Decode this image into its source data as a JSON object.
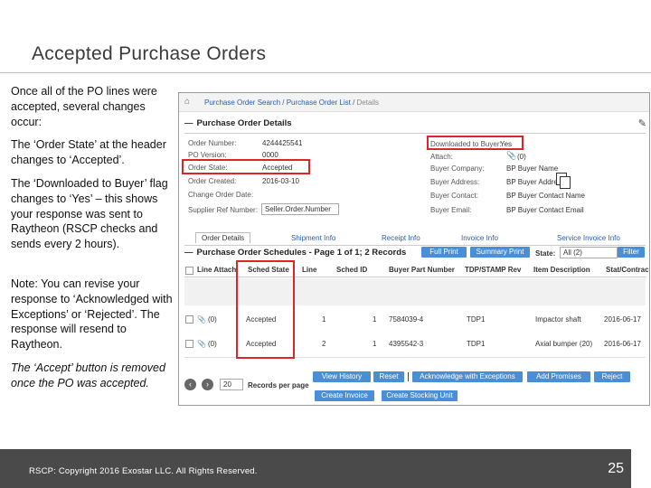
{
  "slide": {
    "title": "Accepted Purchase Orders",
    "notes": {
      "p1": "Once all of the PO lines were accepted, several changes occur:",
      "p2": "The ‘Order State’ at the header changes to ‘Accepted’.",
      "p3": "The ‘Downloaded to Buyer’ flag changes to ‘Yes’ – this shows your response was sent to Raytheon (RSCP checks and sends every 2 hours).",
      "p4": "Note:  You can revise your response to ‘Acknowledged with Exceptions’ or ‘Rejected’. The response will resend to Raytheon.",
      "p5": "The ‘Accept’ button is removed once the PO was accepted."
    },
    "footer": {
      "copyright": "RSCP:  Copyright 2016 Exostar LLC. All Rights Reserved.",
      "page_number": "25"
    }
  },
  "app": {
    "breadcrumb": {
      "part1": "Purchase Order Search",
      "sep1": " / ",
      "part2": "Purchase Order List",
      "sep2": " / ",
      "part3": "Details"
    },
    "details": {
      "heading": "Purchase Order Details",
      "order_number_label": "Order Number:",
      "order_number": "4244425541",
      "po_version_label": "PO Version:",
      "po_version": "0000",
      "order_state_label": "Order State:",
      "order_state": "Accepted",
      "order_created_label": "Order Created:",
      "order_created": "2016-03-10",
      "change_order_date_label": "Change Order Date:",
      "supplier_ref_label": "Supplier Ref Number:",
      "supplier_ref_value": "Seller.Order.Number",
      "downloaded_label": "Downloaded to Buyer:",
      "downloaded_value": "Yes",
      "attach_label": "Attach:",
      "attach_value": "(0)",
      "buyer_company_label": "Buyer Company:",
      "buyer_company": "BP Buyer Name",
      "buyer_address_label": "Buyer Address:",
      "buyer_address": "BP Buyer Address",
      "buyer_contact_label": "Buyer Contact:",
      "buyer_contact": "BP Buyer Contact Name",
      "buyer_email_label": "Buyer Email:",
      "buyer_email": "BP Buyer Contact Email"
    },
    "tabs": [
      "Order Details",
      "Shipment Info",
      "Receipt Info",
      "Invoice Info",
      "Service Invoice Info"
    ],
    "schedules": {
      "heading": "Purchase Order Schedules - Page 1 of 1; 2 Records",
      "full_print": "Full Print",
      "summary_print": "Summary Print",
      "state_label": "State:",
      "state_value": "All (2)",
      "filter": "Filter"
    },
    "columns": [
      "Line Attach",
      "Sched State",
      "Line",
      "Sched ID",
      "Buyer Part Number",
      "TDP/STAMP Rev",
      "Item Description",
      "Stat/Contrac"
    ],
    "rows": [
      {
        "attach": "(0)",
        "state": "Accepted",
        "line": "1",
        "sched": "1",
        "part": "7584039-4",
        "tdp": "TDP1",
        "desc": "Impactor shaft",
        "date": "2016-06-17"
      },
      {
        "attach": "(0)",
        "state": "Accepted",
        "line": "2",
        "sched": "1",
        "part": "4395542-3",
        "tdp": "TDP1",
        "desc": "Axial bumper (20)",
        "date": "2016-06-17"
      }
    ],
    "pager": {
      "per_page": "20",
      "label": "Records per page"
    },
    "actions": {
      "view_history": "View History",
      "reset": "Reset",
      "ack_exceptions": "Acknowledge with Exceptions",
      "add_promises": "Add Promises",
      "reject": "Reject",
      "create_invoice": "Create Invoice",
      "create_stocking": "Create Stocking Unit"
    },
    "colors": {
      "highlight": "#d9262b",
      "button": "#4a8fd6",
      "link": "#2a5db0"
    }
  }
}
